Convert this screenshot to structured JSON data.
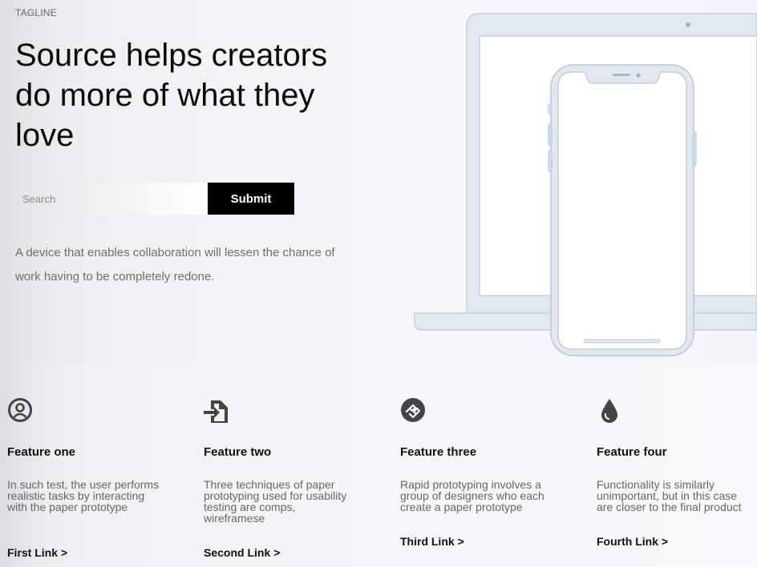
{
  "hero": {
    "tagline": "TAGLINE",
    "headline": "Source helps creators do more of what they love",
    "search": {
      "placeholder": "Search"
    },
    "submit_label": "Submit",
    "description": "A device that enables collaboration will lessen the chance of work having to be completely redone."
  },
  "features": [
    {
      "icon": "user-circle-icon",
      "title": "Feature one",
      "text": "In such test, the user performs realistic tasks by interacting with the paper prototype",
      "link": "First Link >"
    },
    {
      "icon": "file-import-icon",
      "title": "Feature two",
      "text": "Three techniques of paper prototyping used for usability testing are comps, wireframese",
      "link": "Second Link >"
    },
    {
      "icon": "link-badge-icon",
      "title": "Feature three",
      "text": "Rapid prototyping involves a group of designers who each create a paper prototype",
      "link": "Third Link >"
    },
    {
      "icon": "water-drop-icon",
      "title": "Feature four",
      "text": "Functionality is similarly unimportant, but in this case are closer to the final product",
      "link": "Fourth Link >"
    }
  ],
  "colors": {
    "accent": "#000000",
    "device_fill": "#e1e8ef",
    "device_stroke": "#b9c7d6"
  }
}
